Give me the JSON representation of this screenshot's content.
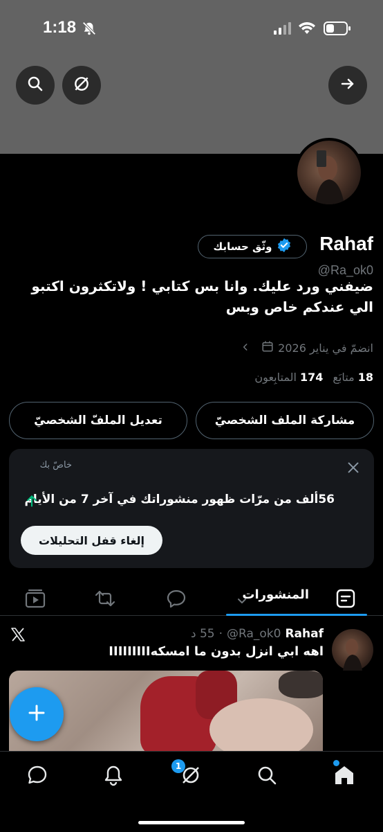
{
  "status_bar": {
    "time": "1:18"
  },
  "profile": {
    "name": "Rahaf",
    "handle": "@Ra_ok0",
    "verify_label": "وثّق حسابك",
    "bio": "ضيفني ورد عليك. وانا بس كتابي ! ولاتكثرون اكتبو الي عندكم خاص وبس",
    "joined": "انضمّ في يناير 2026",
    "following_count": "18",
    "following_label": "متابَع",
    "followers_count": "174",
    "followers_label": "المتابِعون",
    "share_button": "مشاركة الملف الشخصيّ",
    "edit_button": "تعديل الملفّ الشخصيّ"
  },
  "promo": {
    "tag": "خاصّ بك",
    "stat": "56ألف من مرّات ظهور منشوراتك في آخر 7 من الأيام",
    "unlock_button": "إلغاء قفل التحليلات"
  },
  "tabs": {
    "active_label": "المنشورات"
  },
  "post": {
    "author": "Rahaf",
    "handle": "@Ra_ok0",
    "time": "55 د",
    "text": "اهه ابي انزل بدون ما امسكهIIIIIIIII"
  },
  "nav": {
    "notifications_badge": "1"
  },
  "colors": {
    "accent": "#1d9bf0",
    "header": "#636363"
  }
}
